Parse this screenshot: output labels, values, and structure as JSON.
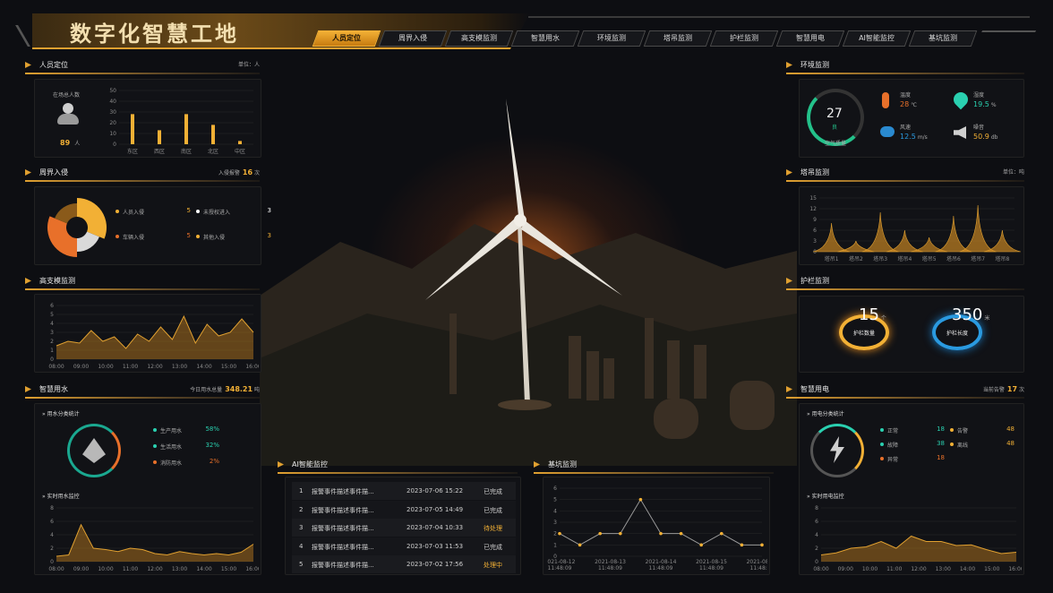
{
  "title": "数字化智慧工地",
  "tabs": [
    "人员定位",
    "周界入侵",
    "高支模监测",
    "智慧用水",
    "环境监测",
    "塔吊监测",
    "护栏监测",
    "智慧用电",
    "AI智能监控",
    "基坑监测"
  ],
  "personnel": {
    "title": "人员定位",
    "unit": "单位：人",
    "total_label": "在场总人数",
    "total_value": "89",
    "total_unit": "人",
    "chart_data": {
      "type": "bar",
      "categories": [
        "东区",
        "西区",
        "南区",
        "北区",
        "中区"
      ],
      "values": [
        28,
        13,
        28,
        18,
        3
      ],
      "ylim": [
        0,
        50
      ]
    }
  },
  "intrusion": {
    "title": "周界入侵",
    "count_label": "入侵报警",
    "count_value": "16",
    "count_unit": "次",
    "legend": [
      {
        "label": "人员入侵",
        "value": "5",
        "color": "#f2b035"
      },
      {
        "label": "未授权进入",
        "value": "3",
        "color": "#ffffff"
      },
      {
        "label": "车辆入侵",
        "value": "5",
        "color": "#e8702a"
      },
      {
        "label": "其他入侵",
        "value": "3",
        "color": "#f2b035"
      }
    ],
    "chart_data": {
      "type": "pie",
      "values": [
        5,
        3,
        5,
        3
      ]
    }
  },
  "formwork": {
    "title": "高支模监测",
    "chart_data": {
      "type": "area",
      "x": [
        "08:00",
        "09:00",
        "10:00",
        "11:00",
        "12:00",
        "13:00",
        "14:00",
        "15:00",
        "16:00"
      ],
      "values": [
        1.5,
        2,
        1.8,
        3.2,
        2,
        2.5,
        1.2,
        2.8,
        2,
        3.6,
        2.2,
        4.8,
        1.8,
        3.9,
        2.6,
        3,
        4.5,
        3
      ],
      "ylim": [
        0,
        6
      ]
    }
  },
  "water": {
    "title": "智慧用水",
    "today_label": "今日用水总量",
    "today_value": "348.21",
    "today_unit": "吨",
    "sub1": "用水分类统计",
    "legend": [
      {
        "label": "生产用水",
        "value": "58%",
        "color": "#2ad0b0"
      },
      {
        "label": "生活用水",
        "value": "32%",
        "color": "#2ad0b0"
      },
      {
        "label": "消防用水",
        "value": "2%",
        "color": "#e8702a"
      }
    ],
    "sub2": "实时用水监控",
    "chart_data": {
      "type": "area",
      "x": [
        "08:00",
        "09:00",
        "10:00",
        "11:00",
        "12:00",
        "13:00",
        "14:00",
        "15:00",
        "16:00"
      ],
      "values": [
        0.8,
        1,
        5.5,
        2,
        1.8,
        1.5,
        2,
        1.8,
        1.2,
        1,
        1.5,
        1.2,
        1,
        1.2,
        1,
        1.4,
        2.6
      ],
      "ylim": [
        0,
        8
      ]
    }
  },
  "ai": {
    "title": "AI智能监控",
    "rows": [
      {
        "no": "1",
        "event": "报警事件描述事件描...",
        "time": "2023-07-06 15:22",
        "status": "已完成",
        "color": "#cfcfcf"
      },
      {
        "no": "2",
        "event": "报警事件描述事件描...",
        "time": "2023-07-05 14:49",
        "status": "已完成",
        "color": "#cfcfcf"
      },
      {
        "no": "3",
        "event": "报警事件描述事件描...",
        "time": "2023-07-04 10:33",
        "status": "待处理",
        "color": "#f2b035"
      },
      {
        "no": "4",
        "event": "报警事件描述事件描...",
        "time": "2023-07-03 11:53",
        "status": "已完成",
        "color": "#cfcfcf"
      },
      {
        "no": "5",
        "event": "报警事件描述事件描...",
        "time": "2023-07-02 17:56",
        "status": "处理中",
        "color": "#f2b035"
      }
    ]
  },
  "pit": {
    "title": "基坑监测",
    "chart_data": {
      "type": "line",
      "x": [
        "2021-08-12 11:48:09",
        "2021-08-13 11:48:09",
        "2021-08-14 11:48:09",
        "2021-08-15 11:48:09",
        "2021-08-16 11:48:09"
      ],
      "values": [
        2,
        1,
        2,
        2,
        5,
        2,
        2,
        1,
        2,
        1,
        1
      ],
      "ylim": [
        0,
        6
      ]
    }
  },
  "env": {
    "title": "环境监测",
    "aqi_value": "27",
    "aqi_unit": "良",
    "aqi_label": "空气质量",
    "items": [
      {
        "label": "温度",
        "value": "28",
        "unit": "℃"
      },
      {
        "label": "湿度",
        "value": "19.5",
        "unit": "%"
      },
      {
        "label": "风速",
        "value": "12.5",
        "unit": "m/s"
      },
      {
        "label": "噪音",
        "value": "50.9",
        "unit": "db"
      }
    ]
  },
  "crane": {
    "title": "塔吊监测",
    "unit": "单位：吨",
    "chart_data": {
      "type": "area",
      "categories": [
        "塔吊1",
        "塔吊2",
        "塔吊3",
        "塔吊4",
        "塔吊5",
        "塔吊6",
        "塔吊7",
        "塔吊8"
      ],
      "values": [
        8,
        3,
        11,
        6,
        4,
        10,
        13,
        6
      ],
      "ylim": [
        0,
        15
      ]
    }
  },
  "rail": {
    "title": "护栏监测",
    "a_value": "15",
    "a_unit": "个",
    "a_label": "护栏数量",
    "b_value": "350",
    "b_unit": "米",
    "b_label": "护栏长度"
  },
  "power": {
    "title": "智慧用电",
    "alarm_label": "当前告警",
    "alarm_value": "17",
    "alarm_unit": "次",
    "sub1": "用电分类统计",
    "legend": [
      {
        "label": "正常",
        "value": "18",
        "color": "#2ad0b0"
      },
      {
        "label": "告警",
        "value": "48",
        "color": "#f2b035"
      },
      {
        "label": "故障",
        "value": "38",
        "color": "#2ad0b0"
      },
      {
        "label": "离线",
        "value": "48",
        "color": "#f2b035"
      },
      {
        "label": "异常",
        "value": "18",
        "color": "#e8702a"
      }
    ],
    "sub2": "实时用电监控",
    "chart_data": {
      "type": "area",
      "x": [
        "08:00",
        "09:00",
        "10:00",
        "11:00",
        "12:00",
        "13:00",
        "14:00",
        "15:00",
        "16:00"
      ],
      "values": [
        1,
        1.3,
        2,
        2.2,
        3,
        2,
        3.8,
        3,
        3,
        2.4,
        2.5,
        1.8,
        1.2,
        1.4
      ],
      "ylim": [
        0,
        8
      ]
    }
  }
}
